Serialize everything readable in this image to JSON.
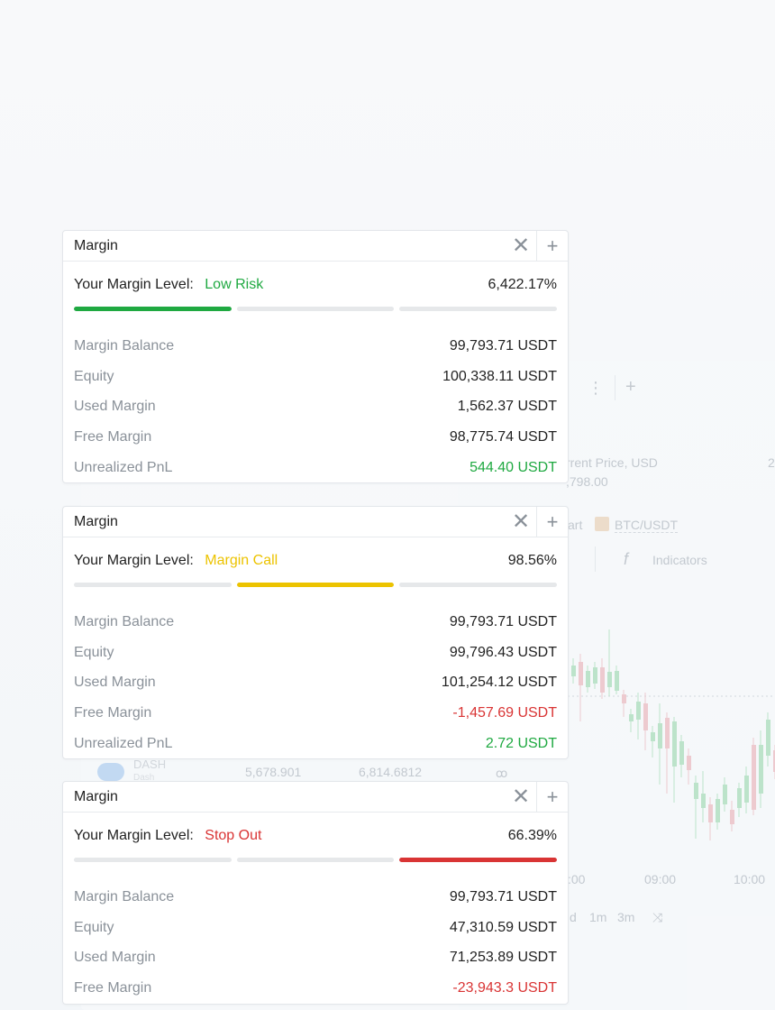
{
  "colors": {
    "low_risk": "#1fa941",
    "margin_call": "#ecc300",
    "stop_out": "#d93434",
    "positive": "#1fa941",
    "negative": "#d93434",
    "bar_track": "#e6e8ea"
  },
  "background": {
    "price_label": "rrent Price, USD",
    "price_value": ",798.00",
    "right_num": "2",
    "chart_tab": "art",
    "pair": "BTC/USDT",
    "indicators": "Indicators",
    "times": [
      ":00",
      "09:00",
      "10:00"
    ],
    "timeframes": [
      "d",
      "1m",
      "3m"
    ],
    "coin_name": "DASH",
    "coin_sub": "Dash",
    "coin_v1": "5,678.901",
    "coin_v2": "6,814.6812",
    "coin_v3": "♀"
  },
  "widgets": [
    {
      "title": "Margin",
      "level_label": "Your Margin Level:",
      "status": "Low Risk",
      "status_color": "#1fa941",
      "level_pct": "6,422.17%",
      "active_segment": 0,
      "stats": [
        {
          "label": "Margin Balance",
          "value": "99,793.71 USDT",
          "tone": "default"
        },
        {
          "label": "Equity",
          "value": "100,338.11 USDT",
          "tone": "default"
        },
        {
          "label": "Used Margin",
          "value": "1,562.37 USDT",
          "tone": "default"
        },
        {
          "label": "Free Margin",
          "value": "98,775.74 USDT",
          "tone": "default"
        },
        {
          "label": "Unrealized PnL",
          "value": "544.40 USDT",
          "tone": "positive"
        }
      ]
    },
    {
      "title": "Margin",
      "level_label": "Your Margin Level:",
      "status": "Margin Call",
      "status_color": "#ecc300",
      "level_pct": "98.56%",
      "active_segment": 1,
      "stats": [
        {
          "label": "Margin Balance",
          "value": "99,793.71 USDT",
          "tone": "default"
        },
        {
          "label": "Equity",
          "value": "99,796.43 USDT",
          "tone": "default"
        },
        {
          "label": "Used Margin",
          "value": "101,254.12 USDT",
          "tone": "default"
        },
        {
          "label": "Free Margin",
          "value": "-1,457.69 USDT",
          "tone": "negative"
        },
        {
          "label": "Unrealized PnL",
          "value": "2.72 USDT",
          "tone": "positive"
        }
      ]
    },
    {
      "title": "Margin",
      "level_label": "Your Margin Level:",
      "status": "Stop Out",
      "status_color": "#d93434",
      "level_pct": "66.39%",
      "active_segment": 2,
      "stats": [
        {
          "label": "Margin Balance",
          "value": "99,793.71 USDT",
          "tone": "default"
        },
        {
          "label": "Equity",
          "value": "47,310.59 USDT",
          "tone": "default"
        },
        {
          "label": "Used Margin",
          "value": "71,253.89 USDT",
          "tone": "default"
        },
        {
          "label": "Free Margin",
          "value": "-23,943.3 USDT",
          "tone": "negative"
        }
      ]
    }
  ]
}
